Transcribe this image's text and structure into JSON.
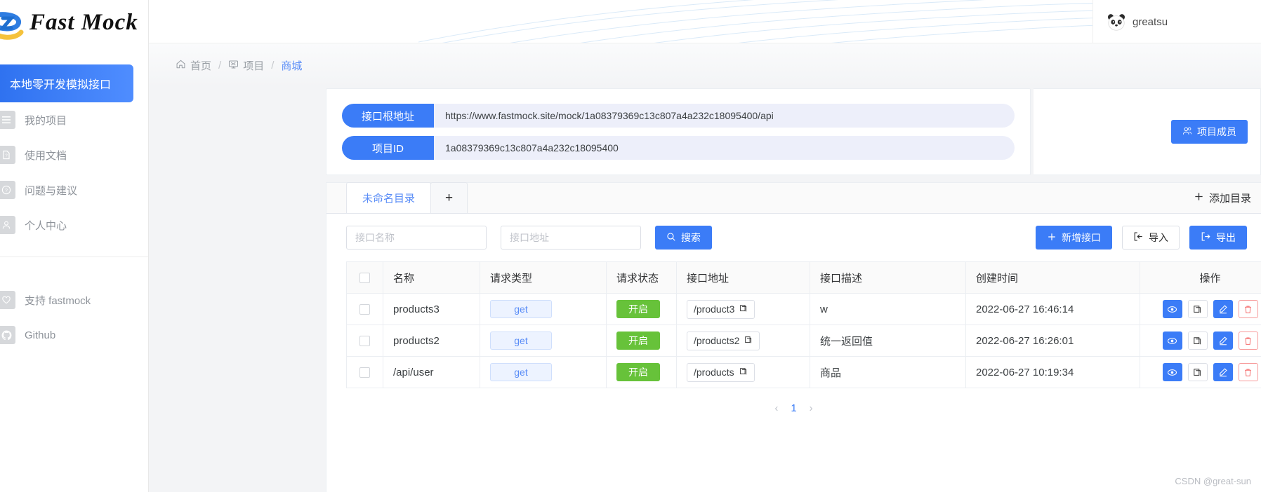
{
  "brand": {
    "name": "Fast Mock"
  },
  "sidebar": {
    "active_item": "本地零开发模拟接口",
    "items": [
      {
        "label": "我的项目",
        "icon": "list-icon"
      },
      {
        "label": "使用文档",
        "icon": "document-icon"
      },
      {
        "label": "问题与建议",
        "icon": "question-icon"
      },
      {
        "label": "个人中心",
        "icon": "user-icon"
      }
    ],
    "footer_items": [
      {
        "label": "支持 fastmock",
        "icon": "heart-icon"
      },
      {
        "label": "Github",
        "icon": "github-icon"
      }
    ]
  },
  "topbar": {
    "username": "greatsu"
  },
  "breadcrumb": [
    {
      "label": "首页",
      "icon": "home-icon",
      "current": false
    },
    {
      "label": "项目",
      "icon": "project-icon",
      "current": false
    },
    {
      "label": "商城",
      "icon": "",
      "current": true
    }
  ],
  "info_card": {
    "rows": [
      {
        "label": "接口根地址",
        "value": "https://www.fastmock.site/mock/1a08379369c13c807a4a232c18095400/api"
      },
      {
        "label": "项目ID",
        "value": "1a08379369c13c807a4a232c18095400"
      }
    ],
    "member_button": "项目成员"
  },
  "tabs": {
    "items": [
      {
        "label": "未命名目录",
        "active": true
      }
    ],
    "add_tab_label": "+",
    "add_directory_label": "添加目录"
  },
  "toolbar": {
    "name_placeholder": "接口名称",
    "name_value": "",
    "path_placeholder": "接口地址",
    "path_value": "",
    "search_label": "搜索",
    "new_api_label": "新增接口",
    "import_label": "导入",
    "export_label": "导出"
  },
  "table": {
    "headers": [
      "",
      "名称",
      "请求类型",
      "请求状态",
      "接口地址",
      "接口描述",
      "创建时间",
      "操作"
    ],
    "rows": [
      {
        "name": "products3",
        "method": "get",
        "status": "开启",
        "path": "/product3",
        "desc": "w",
        "created": "2022-06-27 16:46:14"
      },
      {
        "name": "products2",
        "method": "get",
        "status": "开启",
        "path": "/products2",
        "desc": "统一返回值",
        "created": "2022-06-27 16:26:01"
      },
      {
        "name": "/api/user",
        "method": "get",
        "status": "开启",
        "path": "/products",
        "desc": "商品",
        "created": "2022-06-27 10:19:34"
      }
    ],
    "row_actions": [
      "view-icon",
      "copy-icon",
      "edit-icon",
      "delete-icon"
    ]
  },
  "pagination": {
    "prev": "‹",
    "page": "1",
    "next": "›"
  },
  "watermark": "CSDN @great-sun",
  "colors": {
    "primary": "#3b7cf7",
    "active_nav": "#2f72f0",
    "success": "#67c23a",
    "danger": "#f56c6c",
    "info_value_bg": "#edeffa"
  }
}
